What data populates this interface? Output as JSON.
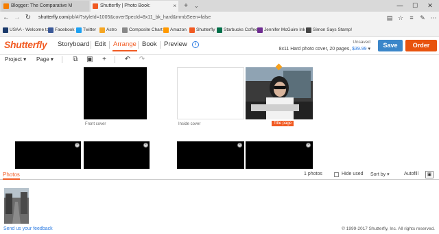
{
  "browser": {
    "tabs": [
      {
        "title": "Blogger: The Comparative M"
      },
      {
        "title": "Shutterfly | Photo Book:"
      }
    ],
    "new_tab": "+",
    "tab_list": "⌄",
    "window_controls": {
      "minimize": "—",
      "maximize": "☐",
      "close": "✕"
    },
    "url_host": "shutterfly.com",
    "url_path": "/pb/#/?styleId=1005&coverSpecId=8x11_bk_hard&mmbSeen=false",
    "favorites": [
      {
        "label": "USAA - Welcome to",
        "color": "#1b3a6b"
      },
      {
        "label": "Facebook",
        "color": "#3b5998"
      },
      {
        "label": "Twitter",
        "color": "#1da1f2"
      },
      {
        "label": "Astro",
        "color": "#f5a623"
      },
      {
        "label": "Composite Chart -",
        "color": "#888888"
      },
      {
        "label": "Amazon",
        "color": "#ff9900"
      },
      {
        "label": "Shutterfly",
        "color": "#f15a22"
      },
      {
        "label": "Starbucks Coffee",
        "color": "#00704a"
      },
      {
        "label": "Jennifer McGuire Ink",
        "color": "#6f2c91"
      },
      {
        "label": "Simon Says Stamp!",
        "color": "#444444"
      }
    ]
  },
  "app": {
    "logo": "Shutterfly",
    "nav": [
      {
        "label": "Storyboard",
        "active": false
      },
      {
        "label": "Edit",
        "active": false
      },
      {
        "label": "Arrange",
        "active": true
      },
      {
        "label": "Book",
        "active": false
      },
      {
        "label": "Preview",
        "active": false
      }
    ],
    "info": "i",
    "status": "Unsaved",
    "product": "8x11 Hard photo cover, 20 pages, ",
    "price": "$39.99",
    "product_caret": "▾",
    "save_label": "Save",
    "order_label": "Order"
  },
  "toolbar": {
    "project": "Project",
    "page": "Page",
    "caret": "▾",
    "undo": "↶",
    "redo": "↷",
    "add": "+"
  },
  "canvas": {
    "front_cover": "Front cover",
    "inside_cover": "Inside cover",
    "title_page": "Title page",
    "remove": "×",
    "warning": "!"
  },
  "tray": {
    "tab": "Photos",
    "photo_count": "1 photos",
    "hide_used": "Hide used",
    "sort_by": "Sort by",
    "autofill": "Autofill",
    "scroll_up": "⌃",
    "scroll_down": "⌄"
  },
  "footer": {
    "feedback": "Send us your feedback",
    "copyright": "© 1999-2017 Shutterfly, Inc. All rights reserved."
  },
  "colors": {
    "brand": "#f15a22",
    "save": "#3b86c9",
    "order": "#e8530e",
    "link": "#2a7ae2"
  }
}
